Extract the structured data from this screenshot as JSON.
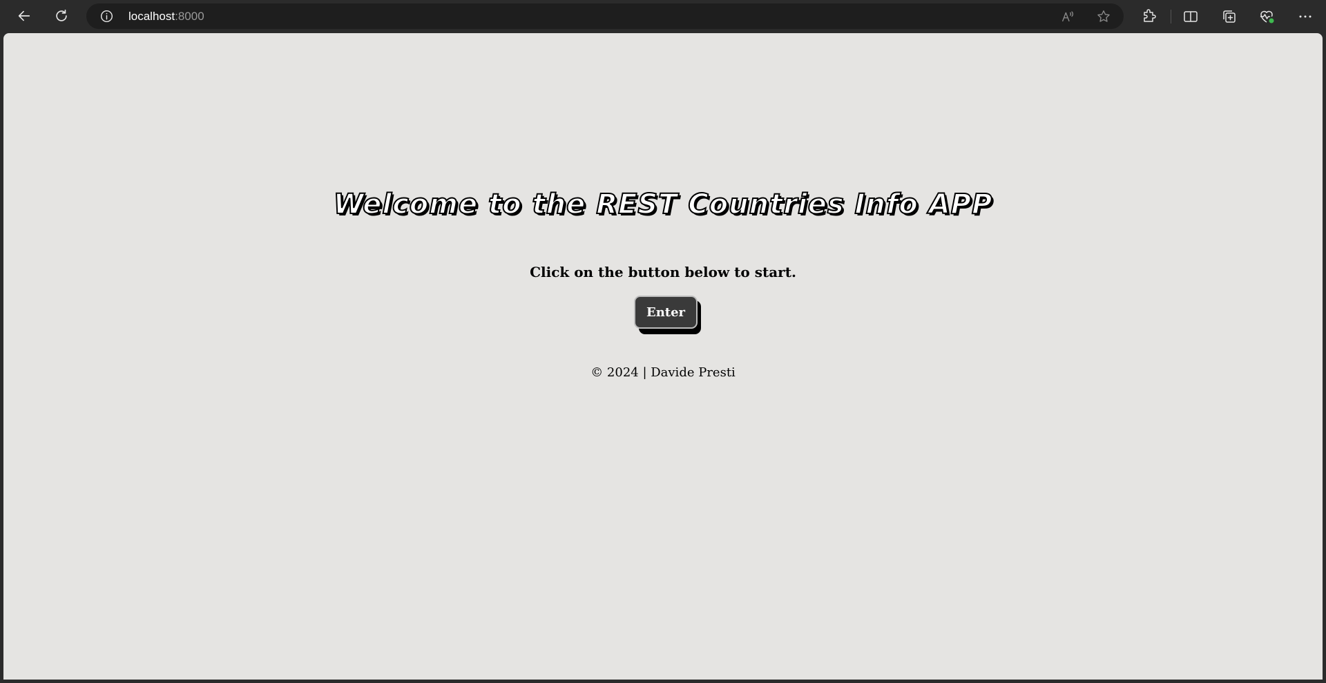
{
  "browser": {
    "url_host": "localhost",
    "url_port": ":8000",
    "icons": {
      "back": "back-arrow-icon",
      "refresh": "refresh-icon",
      "site_info": "info-icon",
      "read_aloud": "read-aloud-icon",
      "favorite": "star-icon",
      "extensions": "puzzle-icon",
      "split_screen": "split-screen-icon",
      "collections": "collections-icon",
      "browser_essentials": "heart-pulse-icon",
      "more": "more-dots-icon"
    }
  },
  "page": {
    "title": "Welcome to the REST Countries Info APP",
    "subtitle": "Click on the button below to start.",
    "enter_label": "Enter",
    "footer": "© 2024 | Davide Presti"
  },
  "colors": {
    "page_background": "#e5e4e2",
    "browser_chrome": "#2b2b2b",
    "button_background": "#3a3a3a",
    "essentials_badge": "#3fb950"
  }
}
